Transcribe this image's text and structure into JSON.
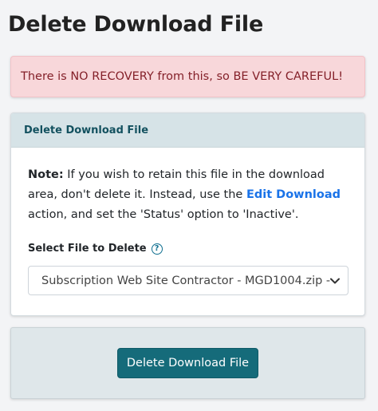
{
  "page": {
    "title": "Delete Download File"
  },
  "alert": {
    "message": "There is NO RECOVERY from this, so BE VERY CAREFUL!"
  },
  "card": {
    "header": "Delete Download File",
    "note": {
      "label": "Note:",
      "text_before": " If you wish to retain this file in the download area, don't delete it. Instead, use the ",
      "link_text": "Edit Download",
      "text_after": " action, and set the 'Status' option to 'Inactive'."
    },
    "select": {
      "label": "Select File to Delete",
      "help_icon_glyph": "?",
      "value": "Subscription Web Site Contractor - MGD1004.zip -"
    }
  },
  "actions": {
    "delete_button": "Delete Download File"
  },
  "colors": {
    "alert_bg": "#f8d7da",
    "alert_text": "#842029",
    "header_bg": "#d6e3e7",
    "header_text": "#13515f",
    "link": "#1a73e8",
    "button_bg": "#156b7a"
  }
}
